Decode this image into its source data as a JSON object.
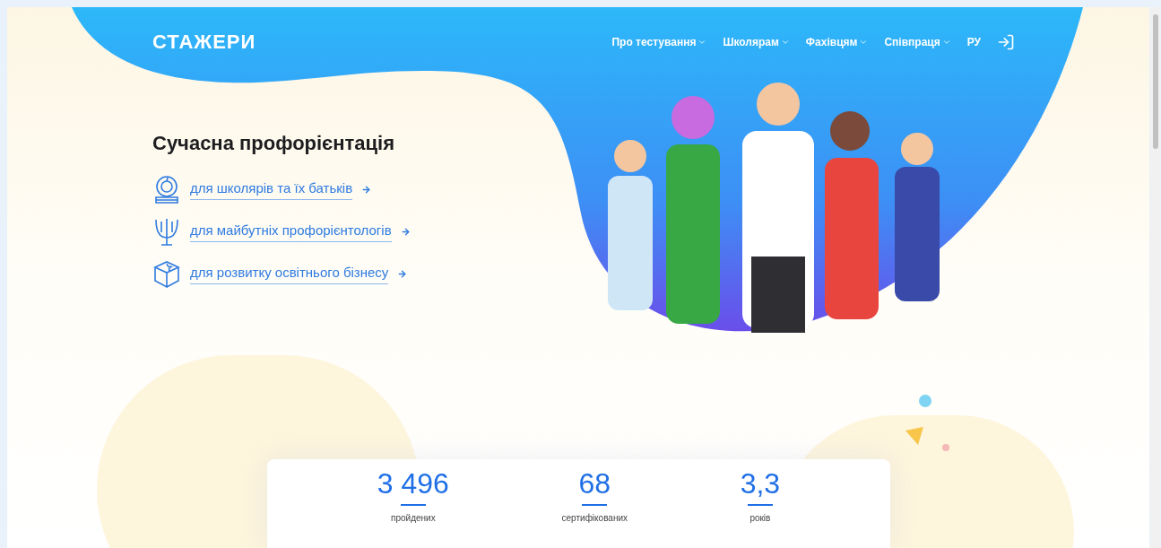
{
  "header": {
    "logo": "СТАЖЕРИ",
    "nav": [
      {
        "label": "Про тестування",
        "dropdown": true
      },
      {
        "label": "Школярам",
        "dropdown": true
      },
      {
        "label": "Фахівцям",
        "dropdown": true
      },
      {
        "label": "Співпраця",
        "dropdown": true
      },
      {
        "label": "РУ",
        "dropdown": false
      }
    ]
  },
  "hero": {
    "title": "Сучасна профорієнтація",
    "links": [
      {
        "label": "для школярів та їх батьків",
        "kind": "apple"
      },
      {
        "label": "для майбутніх профорієнтологів",
        "kind": "psi"
      },
      {
        "label": "для розвитку освітнього бізнесу",
        "kind": "box"
      }
    ]
  },
  "stats": [
    {
      "value": "3 496",
      "label": "пройдених"
    },
    {
      "value": "68",
      "label": "сертифікованих"
    },
    {
      "value": "3,3",
      "label": "років"
    }
  ]
}
